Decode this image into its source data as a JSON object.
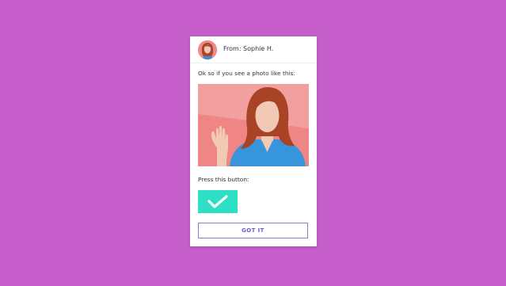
{
  "card": {
    "from_label": "From: Sophie H.",
    "intro_text": "Ok so if you see a photo like this:",
    "press_text": "Press this button:",
    "got_it_label": "GOT IT"
  },
  "icons": {
    "avatar": "avatar-icon",
    "photo": "waving-woman-photo",
    "check": "checkmark-icon"
  },
  "colors": {
    "background": "#c55ecb",
    "check_button": "#2de0c5",
    "got_it_border": "#8d7ad8",
    "got_it_text": "#6d5ccf"
  }
}
